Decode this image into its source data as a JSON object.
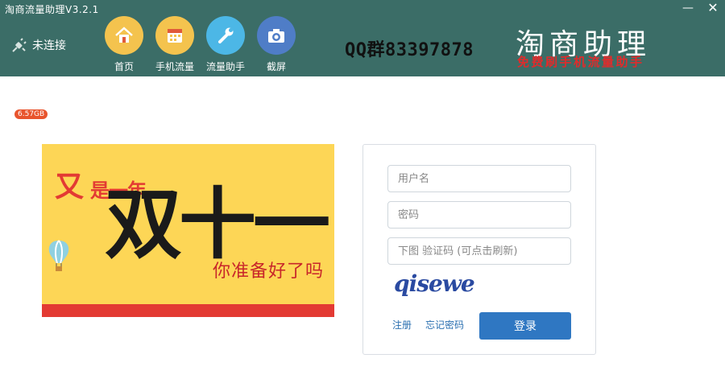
{
  "window": {
    "title": "淘商流量助理V3.2.1",
    "minimize_label": "—",
    "close_label": "✕"
  },
  "connection": {
    "status": "未连接",
    "icon": "plug-disconnected-icon"
  },
  "nav": [
    {
      "label": "首页",
      "icon": "home-icon"
    },
    {
      "label": "手机流量",
      "icon": "calendar-icon"
    },
    {
      "label": "流量助手",
      "icon": "wrench-icon"
    },
    {
      "label": "截屏",
      "icon": "camera-icon"
    }
  ],
  "header": {
    "qq_group": "QQ群83397878",
    "brand": "淘商助理",
    "brand_sub": "免费刷手机流量助手"
  },
  "memory_badge": "6.57GB",
  "banner": {
    "line1_a": "又",
    "line1_b": "是一年",
    "main": "双十一",
    "sub": "你准备好了吗"
  },
  "login": {
    "username_placeholder": "用户名",
    "password_placeholder": "密码",
    "captcha_placeholder": "下图 验证码 (可点击刷新)",
    "captcha_text": "qisewe",
    "register_label": "注册",
    "forgot_label": "忘记密码",
    "submit_label": "登录"
  },
  "colors": {
    "header_bg": "#3b6d67",
    "accent_blue": "#2f77c2",
    "banner_yellow": "#fdd656",
    "banner_red": "#e33a33"
  }
}
